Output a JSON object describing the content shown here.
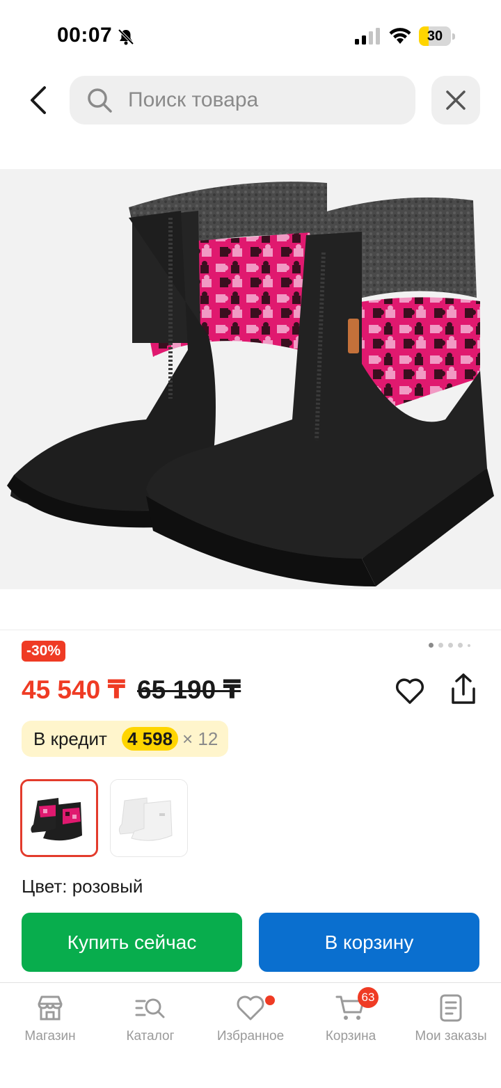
{
  "status_bar": {
    "time": "00:07",
    "battery_level": "30",
    "battery_fraction": 0.3
  },
  "search": {
    "placeholder": "Поиск товара",
    "value": ""
  },
  "product": {
    "discount_badge": "-30%",
    "price": "45 540 ₸",
    "old_price": "65 190 ₸",
    "image_count": 5,
    "active_image_index": 0,
    "color": "Цвет: розовый"
  },
  "credit": {
    "label": "В кредит",
    "amount": "4 598",
    "term": "× 12"
  },
  "variants": [
    {
      "name": "pink",
      "selected": true
    },
    {
      "name": "light-grey",
      "selected": false
    }
  ],
  "actions": {
    "buy_now": "Купить сейчас",
    "add_to_cart": "В корзину"
  },
  "tabbar": {
    "shop": "Магазин",
    "catalog": "Каталог",
    "favorites": "Избранное",
    "cart": "Корзина",
    "cart_count": "63",
    "orders": "Мои заказы"
  },
  "colors": {
    "accent_red": "#ef3b24",
    "buy_green": "#08ad4d",
    "cart_blue": "#0a6fcf",
    "credit_yellow": "#ffd500",
    "credit_bg": "#fff5cc",
    "boot_pink": "#e0196f"
  },
  "icons": {
    "back": "chevron-left-icon",
    "search": "search-icon",
    "close": "close-icon",
    "favorite": "heart-icon",
    "share": "share-icon",
    "shop": "store-icon",
    "catalog": "catalog-search-icon",
    "favorites": "heart-icon",
    "cart": "cart-icon",
    "orders": "orders-icon"
  }
}
